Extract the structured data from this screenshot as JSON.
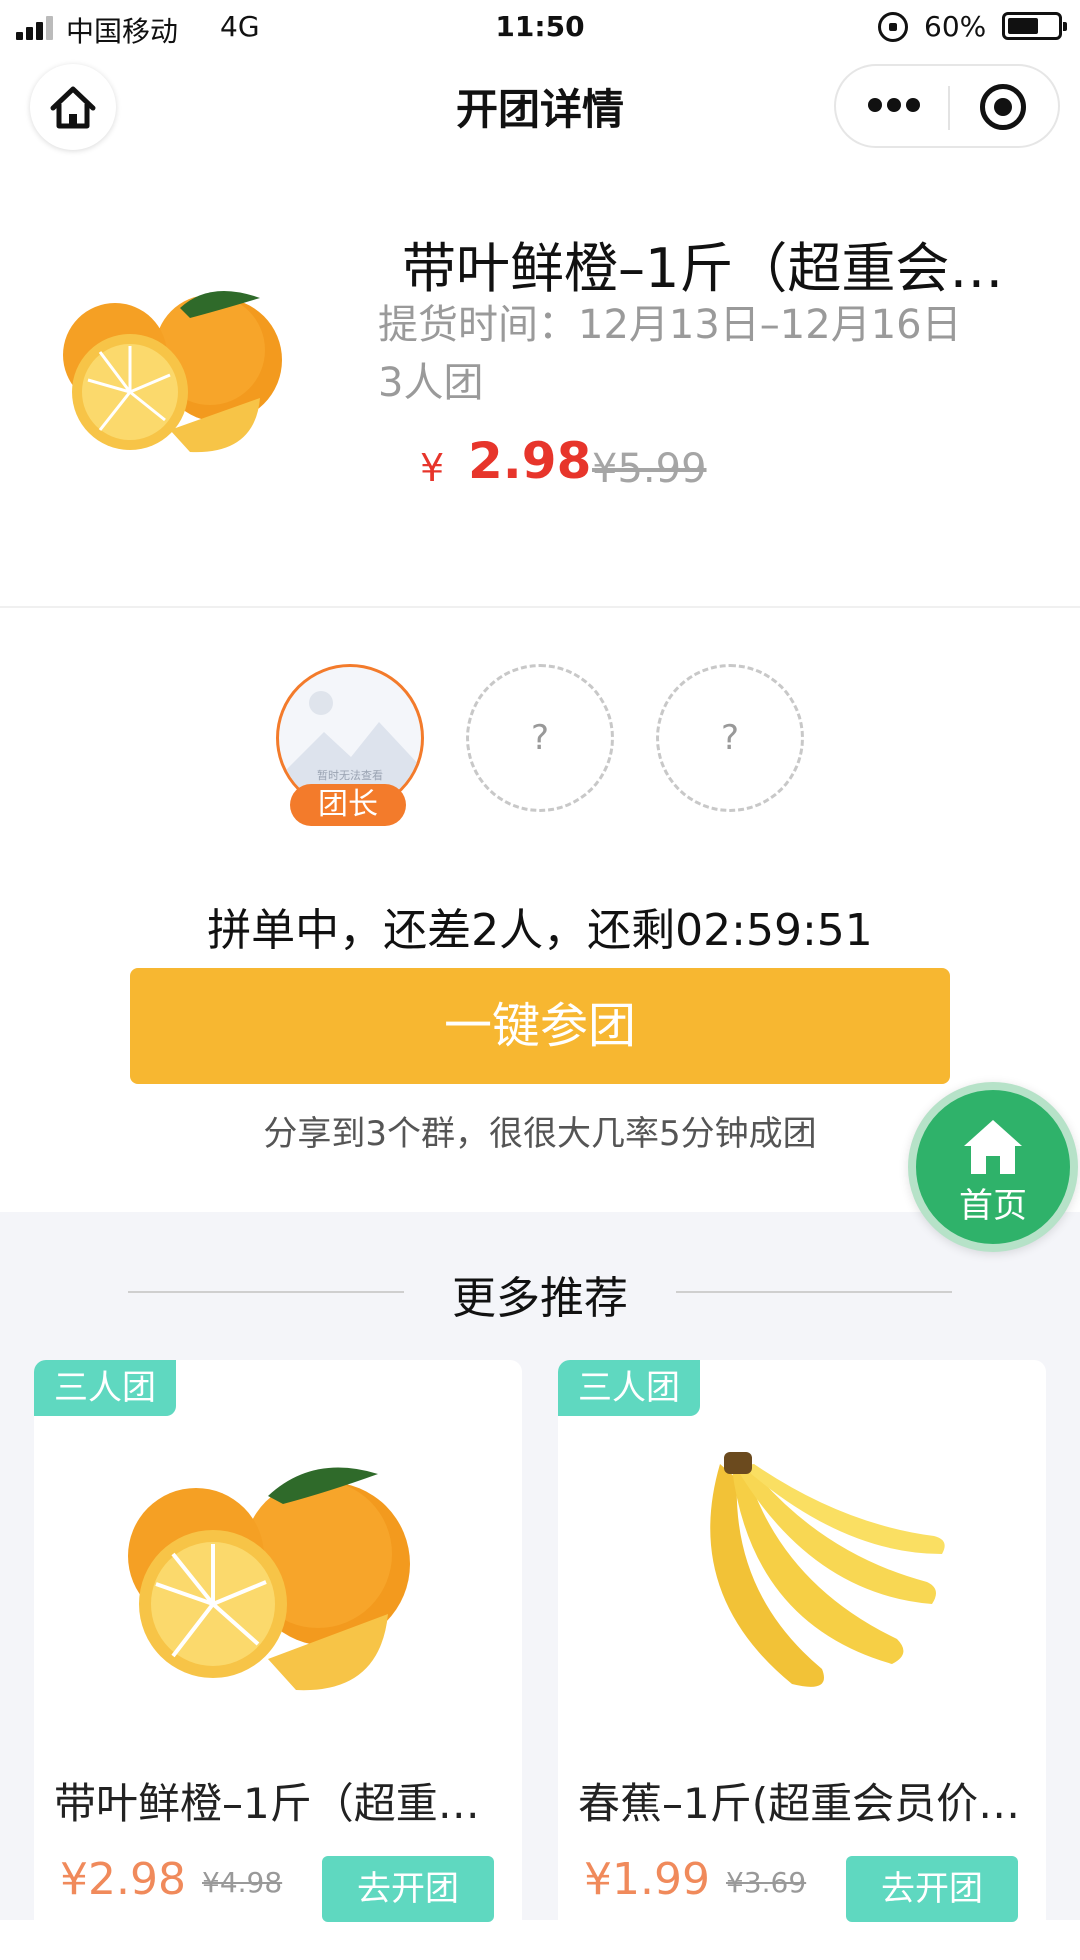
{
  "status_bar": {
    "carrier": "中国移动",
    "network": "4G",
    "time": "11:50",
    "battery": "60%"
  },
  "nav": {
    "title": "开团详情"
  },
  "product": {
    "title": "带叶鲜橙–1斤（超重会…",
    "pickup_time": "提货时间：12月13日–12月16日",
    "group_size": "3人团",
    "currency": "¥",
    "price": "2.98",
    "original_price": "¥5.99"
  },
  "members": {
    "leader_badge": "团长",
    "placeholder_text": "暂时无法查看",
    "empty_slot_mark": "?"
  },
  "group_status": "拼单中，还差2人，还剩02:59:51",
  "join_button": "一键参团",
  "share_hint": "分享到3个群，很很大几率5分钟成团",
  "float_home": {
    "label": "首页"
  },
  "recommend": {
    "title": "更多推荐",
    "items": [
      {
        "tag": "三人团",
        "name": "带叶鲜橙–1斤（超重…",
        "price": "¥2.98",
        "original_price": "¥4.98",
        "button": "去开团",
        "image": "orange"
      },
      {
        "tag": "三人团",
        "name": "春蕉–1斤(超重会员价…",
        "price": "¥1.99",
        "original_price": "¥3.69",
        "button": "去开团",
        "image": "banana"
      }
    ]
  },
  "colors": {
    "price_red": "#e7352b",
    "leader_orange": "#f37b2b",
    "join_yellow": "#f7b731",
    "teal": "#5fd8c0",
    "home_green": "#2fb26a"
  }
}
